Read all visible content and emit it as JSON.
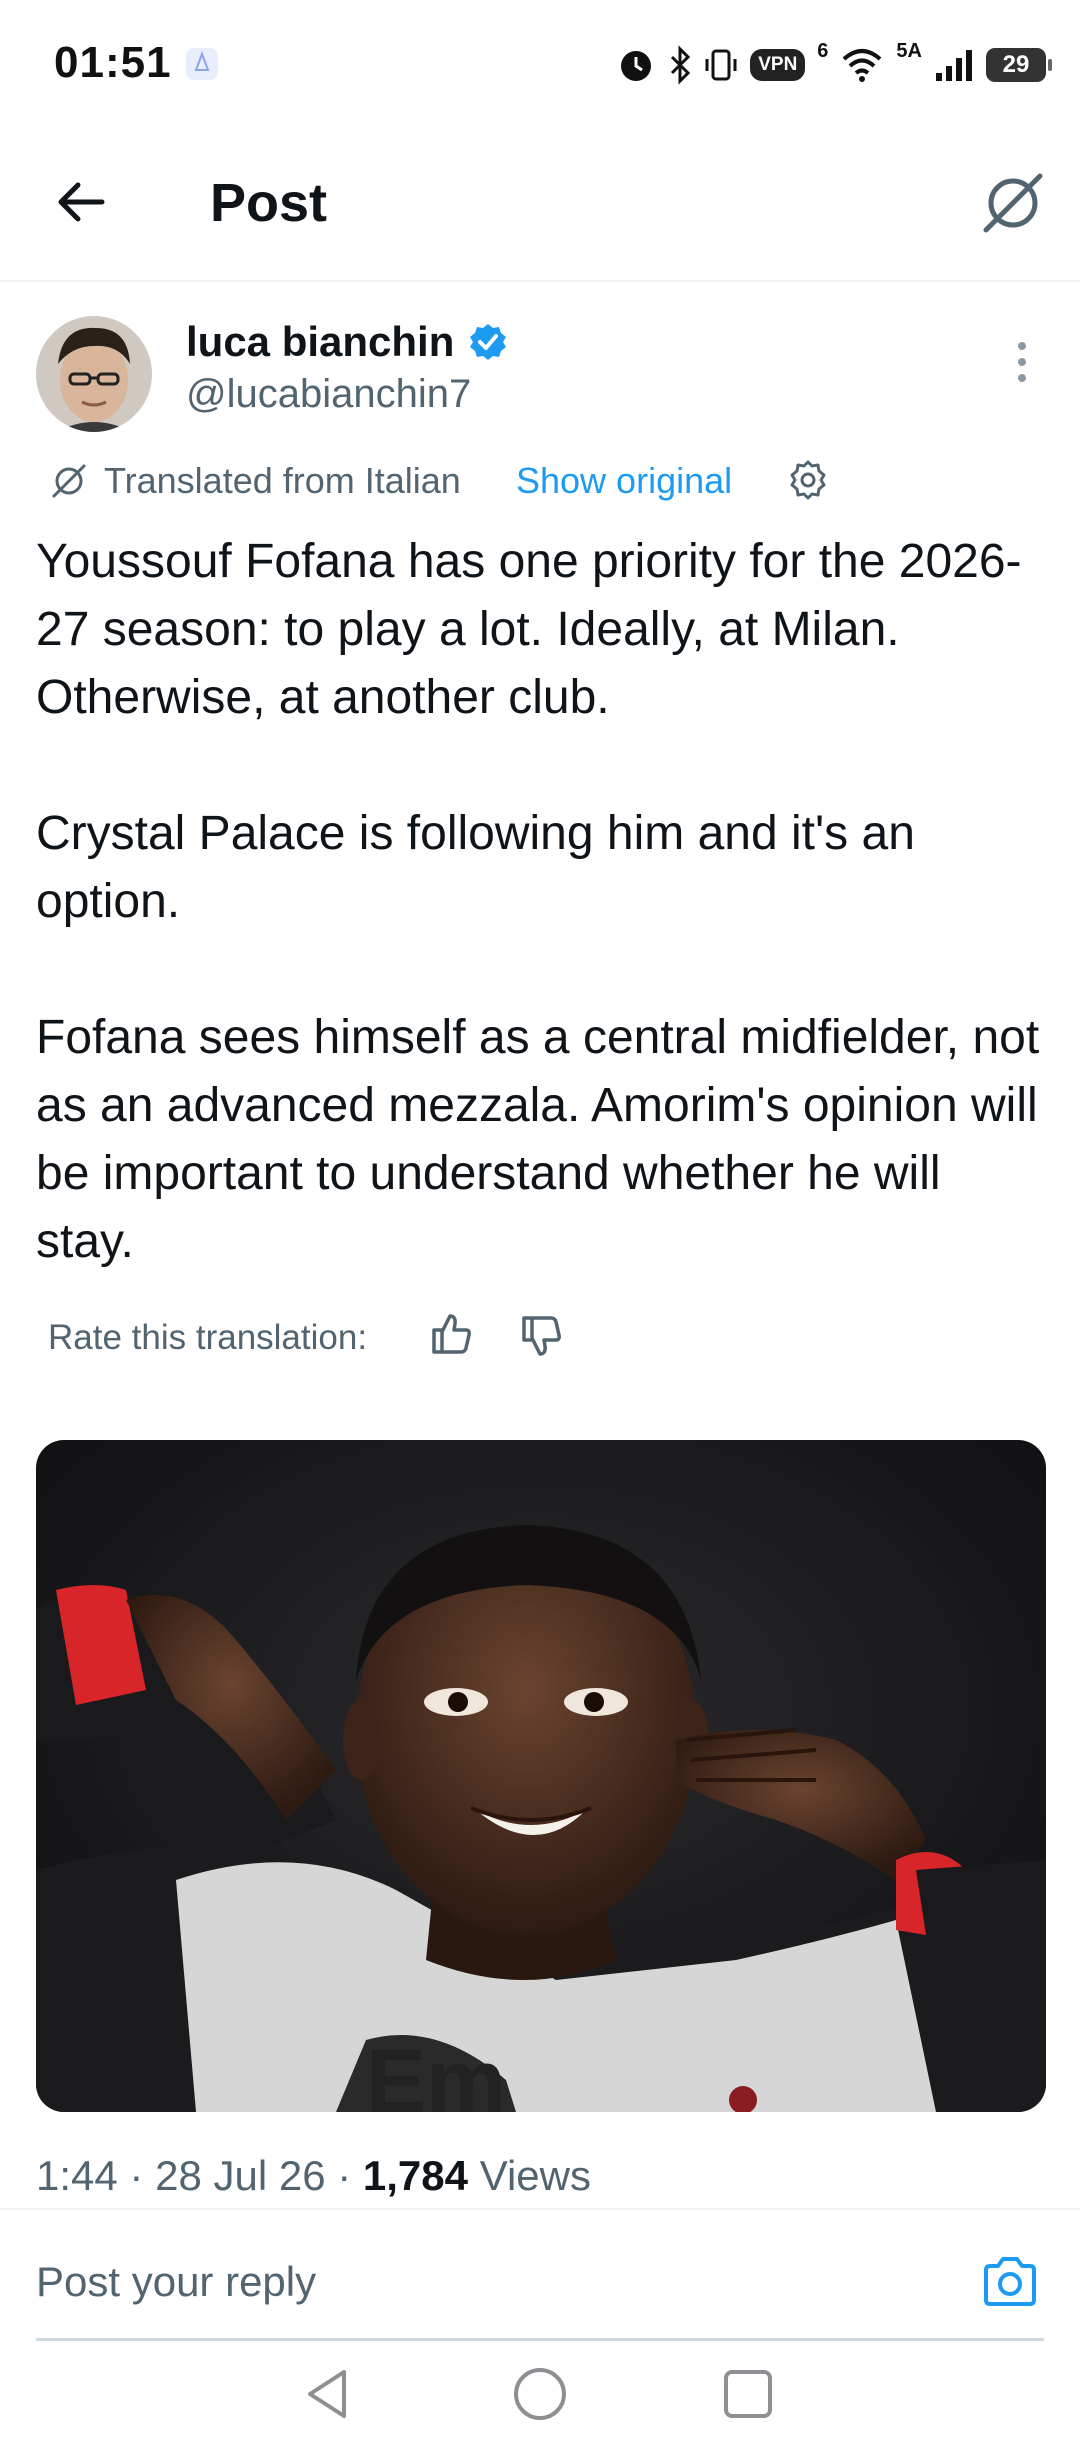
{
  "status_bar": {
    "time": "01:51",
    "vpn_label": "VPN",
    "network_label_1": "6",
    "network_label_2": "5A",
    "battery": "29"
  },
  "header": {
    "title": "Post"
  },
  "post": {
    "author_name": "luca bianchin",
    "handle": "@lucabianchin7",
    "translated_from": "Translated from Italian",
    "show_original": "Show original",
    "paragraphs": [
      "Youssouf Fofana has one priority for the 2026-27 season: to play a lot. Ideally, at Milan. Otherwise, at another club.",
      "Crystal Palace is following him and it's an option.",
      "Fofana sees himself as a central midfielder, not as an advanced mezzala. Amorim's opinion will be important to understand whether he will stay."
    ],
    "rate_label": "Rate this translation:",
    "time": "1:44",
    "date": "28 Jul 26",
    "separator": "·",
    "views_count": "1,784",
    "views_label": "Views"
  },
  "reply": {
    "placeholder": "Post your reply"
  },
  "colors": {
    "accent": "#1d9bf0",
    "secondary_text": "#536471",
    "jersey_red": "#d8252a"
  }
}
